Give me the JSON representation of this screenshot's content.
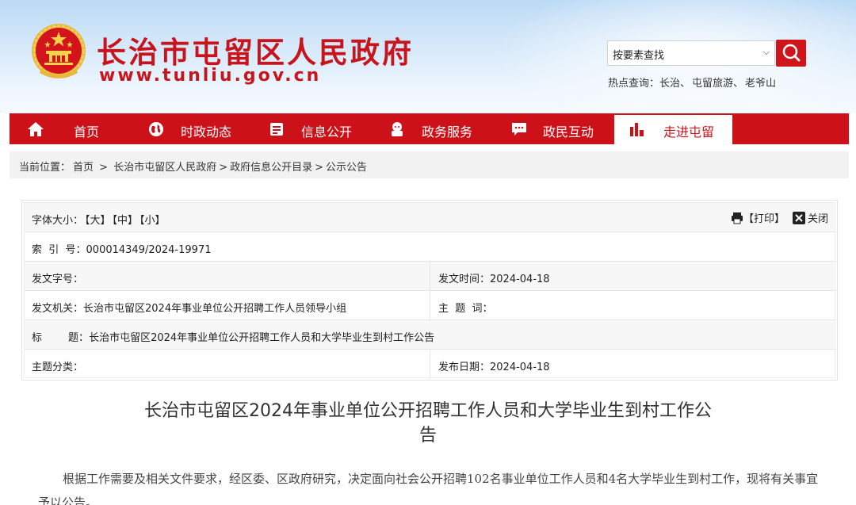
{
  "header": {
    "site_title": "长治市屯留区人民政府",
    "site_url": "www.tunliu.gov.cn",
    "search_select": "按要素查找",
    "hot_label": "热点查询：",
    "hot_keywords": [
      "长治、",
      "屯留旅游、",
      "老爷山"
    ]
  },
  "nav": {
    "items": [
      {
        "label": "首页",
        "icon": "home-icon"
      },
      {
        "label": "时政动态",
        "icon": "globe-icon"
      },
      {
        "label": "信息公开",
        "icon": "document-icon"
      },
      {
        "label": "政务服务",
        "icon": "service-icon"
      },
      {
        "label": "政民互动",
        "icon": "chat-icon"
      },
      {
        "label": "走进屯留",
        "icon": "chart-icon"
      }
    ],
    "active_index": 5
  },
  "breadcrumb": {
    "prefix": "当前位置：",
    "items": [
      "首页",
      " > ",
      "长治市屯留区人民政府",
      ">",
      "政府信息公开目录",
      ">",
      "公示公告"
    ]
  },
  "info": {
    "font_size_label": "字体大小：",
    "font_sizes": [
      "【大】",
      "【中】",
      "【小】"
    ],
    "print_label": "【打印】",
    "close_label": "关闭",
    "index_label": "索  引  号：",
    "index_value": "000014349/2024-19971",
    "doc_no_label": "发文字号：",
    "doc_no_value": "",
    "issue_time_label": "发文时间：",
    "issue_time_value": "2024-04-18",
    "issuer_label": "发文机关：",
    "issuer_value": "长治市屯留区2024年事业单位公开招聘工作人员领导小组",
    "keywords_label": "主  题  词：",
    "keywords_value": "",
    "title_label": "标        题：",
    "title_value": "长治市屯留区2024年事业单位公开招聘工作人员和大学毕业生到村工作公告",
    "category_label": "主题分类：",
    "category_value": "",
    "publish_date_label": "发布日期：",
    "publish_date_value": "2024-04-18"
  },
  "article": {
    "title_line1": "长治市屯留区2024年事业单位公开招聘工作人员和大学毕业生到村工作公",
    "title_line2": "告",
    "paragraph": "根据工作需要及相关文件要求，经区委、区政府研究，决定面向社会公开招聘102名事业单位工作人员和4名大学毕业生到村工作，现将有关事宜予以公告。"
  },
  "colors": {
    "brand_red": "#cc1119",
    "breadcrumb_bg": "#f2f2f2"
  }
}
